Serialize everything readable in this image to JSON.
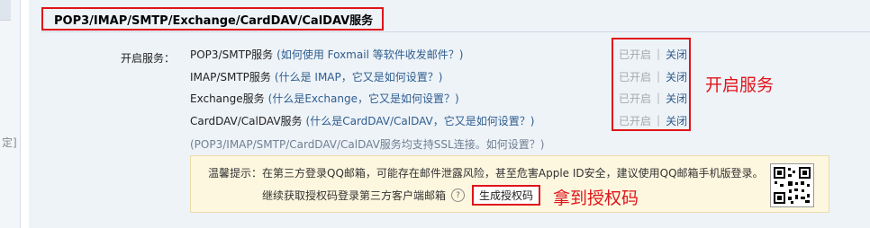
{
  "left_edge": {
    "cut_char": "定]"
  },
  "section": {
    "title": "POP3/IMAP/SMTP/Exchange/CardDAV/CalDAV服务"
  },
  "services": {
    "label": "开启服务：",
    "rows": [
      {
        "name": "POP3/SMTP服务",
        "help": "(如何使用 Foxmail 等软件收发邮件？)",
        "status_on": "已开启",
        "sep": "|",
        "status_off": "关闭"
      },
      {
        "name": "IMAP/SMTP服务",
        "help": "(什么是 IMAP，它又是如何设置？)",
        "status_on": "已开启",
        "sep": "|",
        "status_off": "关闭"
      },
      {
        "name": "Exchange服务",
        "help": "(什么是Exchange，它又是如何设置？)",
        "status_on": "已开启",
        "sep": "|",
        "status_off": "关闭"
      },
      {
        "name": "CardDAV/CalDAV服务",
        "help": "(什么是CardDAV/CalDAV，它又是如何设置？)",
        "status_on": "已开启",
        "sep": "|",
        "status_off": "关闭"
      }
    ],
    "ssl_note": "(POP3/IMAP/SMTP/CardDAV/CalDAV服务均支持SSL连接。如何设置？)"
  },
  "annotations": {
    "enable": "开启服务",
    "get_code": "拿到授权码"
  },
  "tip": {
    "line1": "温馨提示：在第三方登录QQ邮箱，可能存在邮件泄露风险，甚至危害Apple ID安全，建议使用QQ邮箱手机版登录。",
    "line2": "继续获取授权码登录第三方客户端邮箱",
    "help_glyph": "?",
    "button": "生成授权码"
  },
  "colors": {
    "accent_red": "#e0141a",
    "link": "#2e5d8e",
    "tip_bg": "#fdf7df"
  }
}
